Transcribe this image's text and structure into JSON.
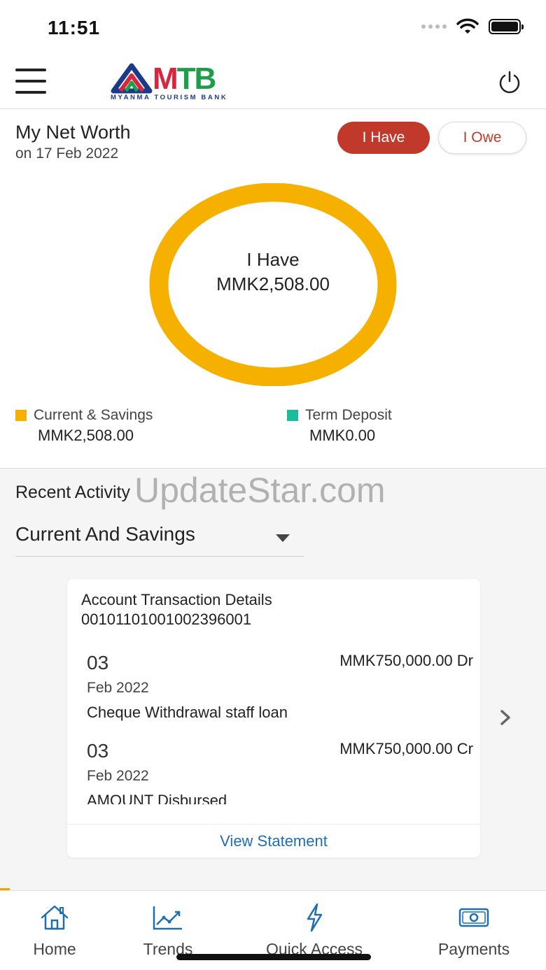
{
  "status_bar": {
    "time": "11:51"
  },
  "header": {
    "logo_text_m": "M",
    "logo_text_tb": "TB",
    "logo_subtitle": "MYANMA TOURISM BANK"
  },
  "net_worth": {
    "title": "My Net Worth",
    "date": "on 17 Feb 2022",
    "tabs": {
      "have": "I Have",
      "owe": "I Owe"
    },
    "donut": {
      "label": "I Have",
      "value": "MMK2,508.00"
    },
    "legend": [
      {
        "name": "Current & Savings",
        "value": "MMK2,508.00",
        "color": "#f5b000"
      },
      {
        "name": "Term Deposit",
        "value": "MMK0.00",
        "color": "#1abc9c"
      }
    ]
  },
  "recent_activity": {
    "title": "Recent Activity",
    "watermark": "UpdateStar.com",
    "account_type": "Current And Savings",
    "card": {
      "heading": "Account Transaction Details",
      "account_number": "0010110100100239600​1",
      "transactions": [
        {
          "day": "03",
          "month_year": "Feb 2022",
          "amount": "MMK750,000.00 Dr",
          "description": "Cheque Withdrawal staff loan"
        },
        {
          "day": "03",
          "month_year": "Feb 2022",
          "amount": "MMK750,000.00 Cr",
          "description": "AMOUNT Disbursed"
        }
      ],
      "footer_link": "View Statement"
    }
  },
  "tab_bar": {
    "items": [
      {
        "label": "Home",
        "icon": "home-icon"
      },
      {
        "label": "Trends",
        "icon": "trends-icon"
      },
      {
        "label": "Quick Access",
        "icon": "lightning-icon"
      },
      {
        "label": "Payments",
        "icon": "cash-icon"
      }
    ]
  },
  "colors": {
    "accent_red": "#c0392b",
    "donut": "#f5b000",
    "link": "#1f6fb0"
  }
}
